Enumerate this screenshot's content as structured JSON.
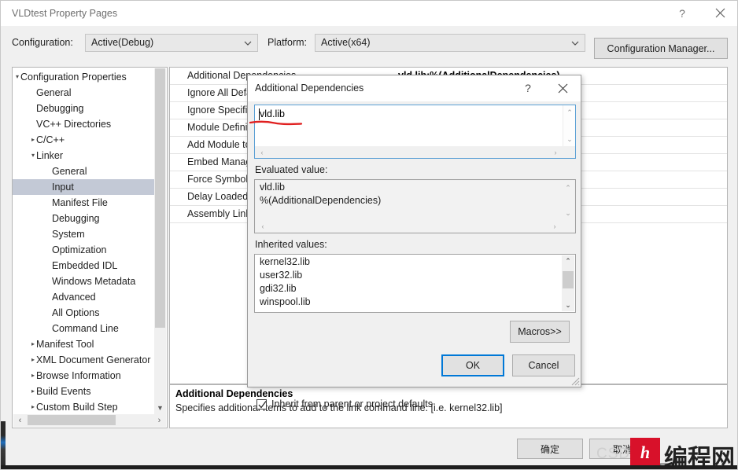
{
  "window": {
    "title": "VLDtest Property Pages",
    "help_icon": "question-mark-icon",
    "close_icon": "close-icon"
  },
  "toolbar": {
    "configuration_label": "Configuration:",
    "configuration_value": "Active(Debug)",
    "platform_label": "Platform:",
    "platform_value": "Active(x64)",
    "configuration_manager_label": "Configuration Manager..."
  },
  "tree": [
    {
      "label": "Configuration Properties",
      "indent": 0,
      "twisty": "collapse",
      "selected": false
    },
    {
      "label": "General",
      "indent": 1,
      "twisty": "none",
      "selected": false
    },
    {
      "label": "Debugging",
      "indent": 1,
      "twisty": "none",
      "selected": false
    },
    {
      "label": "VC++ Directories",
      "indent": 1,
      "twisty": "none",
      "selected": false
    },
    {
      "label": "C/C++",
      "indent": 1,
      "twisty": "expand",
      "selected": false
    },
    {
      "label": "Linker",
      "indent": 1,
      "twisty": "collapse",
      "selected": false
    },
    {
      "label": "General",
      "indent": 2,
      "twisty": "none",
      "selected": false
    },
    {
      "label": "Input",
      "indent": 2,
      "twisty": "none",
      "selected": true
    },
    {
      "label": "Manifest File",
      "indent": 2,
      "twisty": "none",
      "selected": false
    },
    {
      "label": "Debugging",
      "indent": 2,
      "twisty": "none",
      "selected": false
    },
    {
      "label": "System",
      "indent": 2,
      "twisty": "none",
      "selected": false
    },
    {
      "label": "Optimization",
      "indent": 2,
      "twisty": "none",
      "selected": false
    },
    {
      "label": "Embedded IDL",
      "indent": 2,
      "twisty": "none",
      "selected": false
    },
    {
      "label": "Windows Metadata",
      "indent": 2,
      "twisty": "none",
      "selected": false
    },
    {
      "label": "Advanced",
      "indent": 2,
      "twisty": "none",
      "selected": false
    },
    {
      "label": "All Options",
      "indent": 2,
      "twisty": "none",
      "selected": false
    },
    {
      "label": "Command Line",
      "indent": 2,
      "twisty": "none",
      "selected": false
    },
    {
      "label": "Manifest Tool",
      "indent": 1,
      "twisty": "expand",
      "selected": false
    },
    {
      "label": "XML Document Generator",
      "indent": 1,
      "twisty": "expand",
      "selected": false
    },
    {
      "label": "Browse Information",
      "indent": 1,
      "twisty": "expand",
      "selected": false
    },
    {
      "label": "Build Events",
      "indent": 1,
      "twisty": "expand",
      "selected": false
    },
    {
      "label": "Custom Build Step",
      "indent": 1,
      "twisty": "expand",
      "selected": false
    }
  ],
  "properties": [
    {
      "name": "Additional Dependencies",
      "value": "vld.lib;%(AdditionalDependencies)"
    },
    {
      "name": "Ignore All Default Libraries",
      "value": ""
    },
    {
      "name": "Ignore Specific Default Libraries",
      "value": ""
    },
    {
      "name": "Module Definition File",
      "value": ""
    },
    {
      "name": "Add Module to Assembly",
      "value": ""
    },
    {
      "name": "Embed Managed Resource File",
      "value": ""
    },
    {
      "name": "Force Symbol References",
      "value": ""
    },
    {
      "name": "Delay Loaded Dlls",
      "value": ""
    },
    {
      "name": "Assembly Link Resource",
      "value": ""
    }
  ],
  "description": {
    "title": "Additional Dependencies",
    "body": "Specifies additional items to add to the link command line. [i.e. kernel32.lib]"
  },
  "footer": {
    "ok_label": "确定",
    "cancel_label": "取消"
  },
  "dialog": {
    "title": "Additional Dependencies",
    "help_icon": "question-mark-icon",
    "close_icon": "close-icon",
    "edit_value": "vld.lib",
    "evaluated_label": "Evaluated value:",
    "evaluated_values": [
      "vld.lib",
      "%(AdditionalDependencies)"
    ],
    "inherited_label": "Inherited values:",
    "inherited_values": [
      "kernel32.lib",
      "user32.lib",
      "gdi32.lib",
      "winspool.lib"
    ],
    "inherit_checkbox_label": "Inherit from parent or project defaults",
    "inherit_checked": true,
    "macros_label": "Macros>>",
    "ok_label": "OK",
    "cancel_label": "Cancel"
  },
  "watermark": {
    "csdn": "CSDN",
    "logo_glyph": "h",
    "brand": "编程网",
    "ghost": "编程网"
  },
  "colors": {
    "accent_focus": "#0078d7",
    "edit_border": "#5a9fd4",
    "selection": "#c3c9d6",
    "annotation_red": "#e02020",
    "logo_red": "#d8112a"
  }
}
